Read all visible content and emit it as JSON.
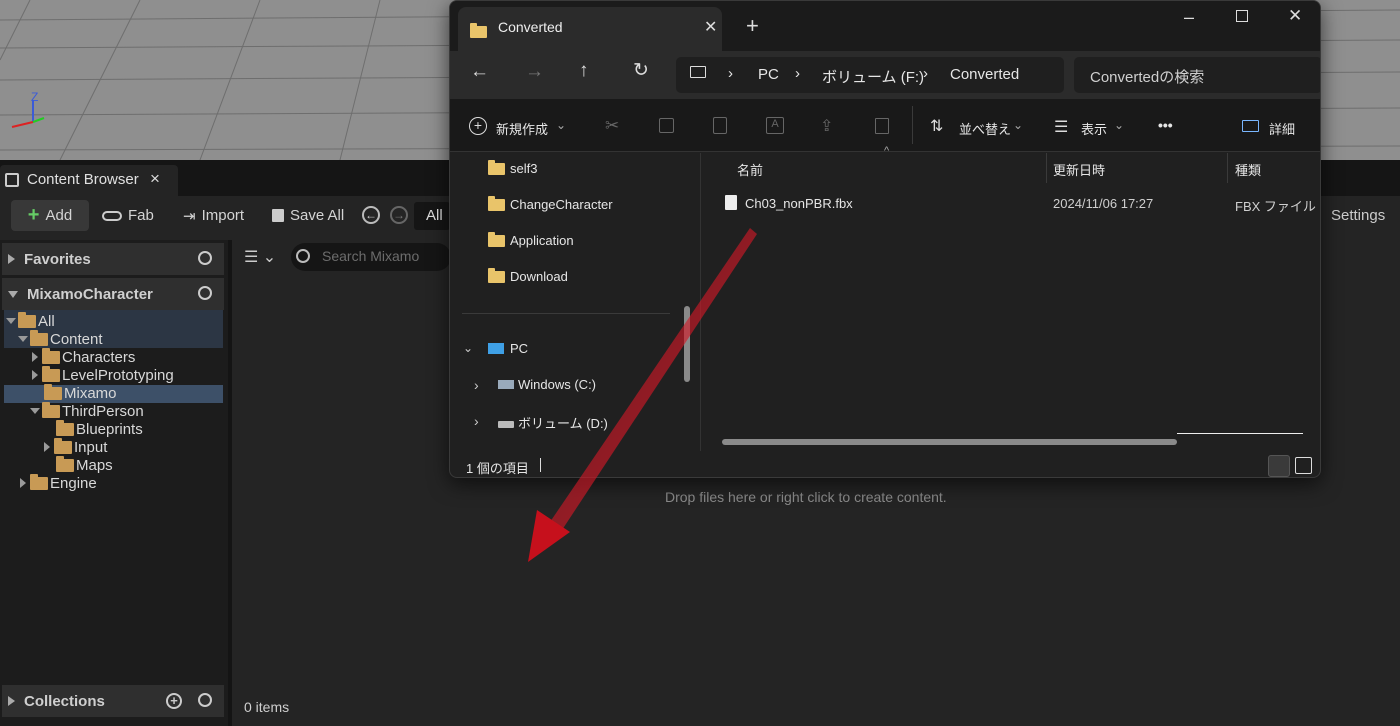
{
  "content_browser": {
    "tab_title": "Content Browser",
    "tab_close": "×",
    "toolbar": {
      "add": "Add",
      "fab": "Fab",
      "import": "Import",
      "save_all": "Save All",
      "all": "All",
      "settings": "Settings"
    },
    "search_placeholder": "Search Mixamo",
    "favorites": "Favorites",
    "project": "MixamoCharacter",
    "collections": "Collections",
    "tree": [
      {
        "label": "All"
      },
      {
        "label": "Content"
      },
      {
        "label": "Characters"
      },
      {
        "label": "LevelPrototyping"
      },
      {
        "label": "Mixamo"
      },
      {
        "label": "ThirdPerson"
      },
      {
        "label": "Blueprints"
      },
      {
        "label": "Input"
      },
      {
        "label": "Maps"
      },
      {
        "label": "Engine"
      }
    ],
    "drop_hint": "Drop files here or right click to create content.",
    "item_count": "0 items"
  },
  "explorer": {
    "tab_title": "Converted",
    "breadcrumb": [
      "PC",
      "ボリューム (F:)",
      "Converted"
    ],
    "search_placeholder": "Convertedの検索",
    "commands": {
      "new": "新規作成",
      "sort": "並べ替え",
      "view": "表示",
      "more": "•••",
      "details": "詳細"
    },
    "sidebar": [
      {
        "label": "self3"
      },
      {
        "label": "ChangeCharacter"
      },
      {
        "label": "Application"
      },
      {
        "label": "Download"
      },
      {
        "label": "PC"
      },
      {
        "label": "Windows (C:)"
      },
      {
        "label": "ボリューム (D:)"
      }
    ],
    "columns": {
      "name": "名前",
      "date": "更新日時",
      "type": "種類"
    },
    "files": [
      {
        "name": "Ch03_nonPBR.fbx",
        "date": "2024/11/06 17:27",
        "type": "FBX ファイル"
      }
    ],
    "status": "1 個の項目"
  },
  "viewport": {
    "axis_z": "Z"
  },
  "colors": {
    "highlight": "#3d5068",
    "arrow": "#d0101c",
    "folder": "#c89a55"
  }
}
